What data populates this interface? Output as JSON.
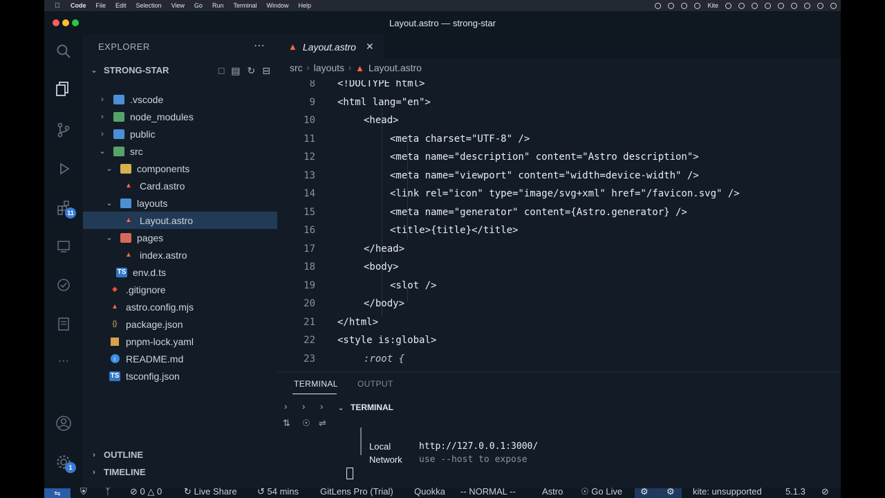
{
  "menubar": {
    "app": "Code",
    "items": [
      "File",
      "Edit",
      "Selection",
      "View",
      "Go",
      "Run",
      "Terminal",
      "Window",
      "Help"
    ],
    "tray_kite": "Kite"
  },
  "window": {
    "title": "Layout.astro — strong-star"
  },
  "activity": {
    "source_control_badge": "11",
    "accounts_badge": "1"
  },
  "sidebar": {
    "title": "EXPLORER",
    "root": "STRONG-STAR",
    "items": [
      {
        "label": ".vscode"
      },
      {
        "label": "node_modules"
      },
      {
        "label": "public"
      },
      {
        "label": "src"
      },
      {
        "label": "components"
      },
      {
        "label": "Card.astro"
      },
      {
        "label": "layouts"
      },
      {
        "label": "Layout.astro"
      },
      {
        "label": "pages"
      },
      {
        "label": "index.astro"
      },
      {
        "label": "env.d.ts"
      },
      {
        "label": ".gitignore"
      },
      {
        "label": "astro.config.mjs"
      },
      {
        "label": "package.json"
      },
      {
        "label": "pnpm-lock.yaml"
      },
      {
        "label": "README.md"
      },
      {
        "label": "tsconfig.json"
      }
    ],
    "outline": "OUTLINE",
    "timeline": "TIMELINE"
  },
  "editor": {
    "tab_label": "Layout.astro",
    "breadcrumbs": [
      "src",
      "layouts",
      "Layout.astro"
    ],
    "lines": [
      {
        "n": "8",
        "text": "<!DOCTYPE html>"
      },
      {
        "n": "9",
        "text": "<html lang=\"en\">"
      },
      {
        "n": "10",
        "text": "<head>"
      },
      {
        "n": "11",
        "text": "<meta charset=\"UTF-8\" />"
      },
      {
        "n": "12",
        "text": "<meta name=\"description\" content=\"Astro description\">"
      },
      {
        "n": "13",
        "text": "<meta name=\"viewport\" content=\"width=device-width\" />"
      },
      {
        "n": "14",
        "text": "<link rel=\"icon\" type=\"image/svg+xml\" href=\"/favicon.svg\" />"
      },
      {
        "n": "15",
        "text": "<meta name=\"generator\" content={Astro.generator} />"
      },
      {
        "n": "16",
        "text": "<title>{title}</title>"
      },
      {
        "n": "17",
        "text": "</head>"
      },
      {
        "n": "18",
        "text": "<body>"
      },
      {
        "n": "19",
        "text": "<slot />"
      },
      {
        "n": "20",
        "text": "</body>"
      },
      {
        "n": "21",
        "text": "</html>"
      },
      {
        "n": "22",
        "text": "<style is:global>"
      },
      {
        "n": "23",
        "text": ":root {"
      }
    ]
  },
  "panel": {
    "tabs": [
      "TERMINAL",
      "OUTPUT"
    ],
    "terminal_header": "TERMINAL",
    "local_label": "Local",
    "local_value": "http://127.0.0.1:3000/",
    "network_label": "Network",
    "network_value": "use --host to expose"
  },
  "statusbar": {
    "errors": "0",
    "warnings": "0",
    "live_share": "Live Share",
    "time": "54 mins",
    "gitlens": "GitLens Pro (Trial)",
    "quokka": "Quokka",
    "mode": "-- NORMAL --",
    "language": "Astro",
    "go_live": "Go Live",
    "kite": "kite: unsupported",
    "version": "5.1.3"
  }
}
